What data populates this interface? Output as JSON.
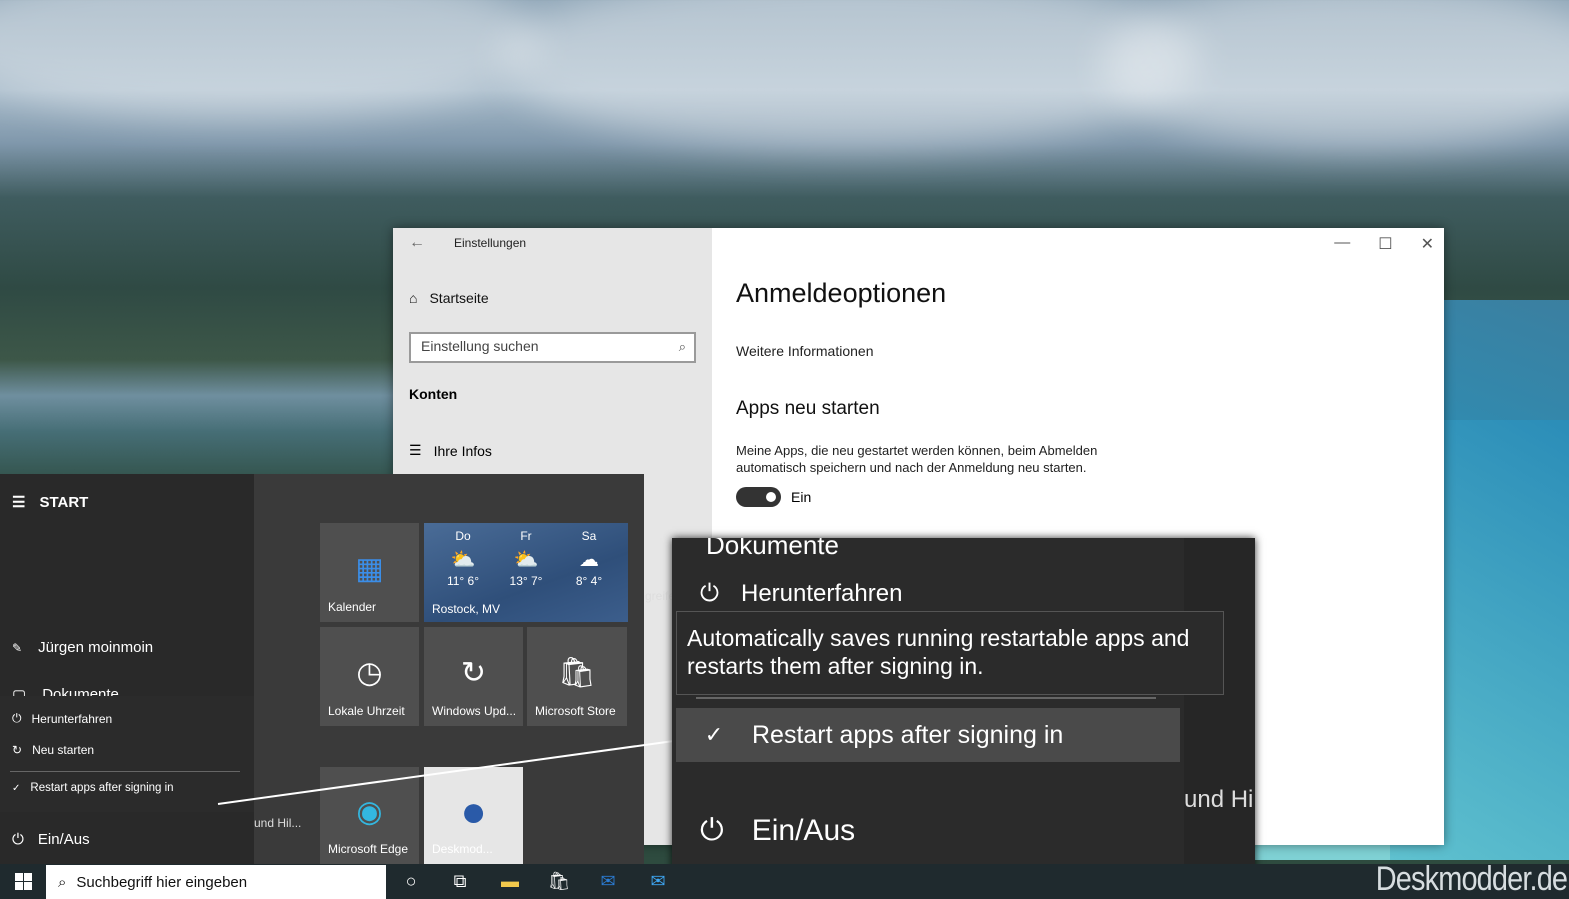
{
  "settings": {
    "title": "Einstellungen",
    "home": "Startseite",
    "search_placeholder": "Einstellung suchen",
    "section": "Konten",
    "nav_item": "Ihre Infos",
    "page_title": "Anmeldeoptionen",
    "more_info": "Weitere Informationen",
    "subtitle": "Apps neu starten",
    "description": "Meine Apps, die neu gestartet werden können, beim Abmelden automatisch speichern und nach der Anmeldung neu starten.",
    "toggle_label": "Ein",
    "toggle_on": true
  },
  "start": {
    "heading": "START",
    "user": "Jürgen moinmoin",
    "documents": "Dokumente",
    "power_menu": {
      "shutdown": "Herunterfahren",
      "restart": "Neu starten",
      "restart_apps": "Restart apps after signing in"
    },
    "power": "Ein/Aus",
    "cut_text_1": "greife",
    "cut_text_2": "und Hil...",
    "tiles": {
      "calendar": "Kalender",
      "clock": "Lokale Uhrzeit",
      "update": "Windows Upd...",
      "store": "Microsoft Store",
      "edge": "Microsoft Edge",
      "deskmodder": "Deskmod..."
    },
    "weather": {
      "location": "Rostock, MV",
      "days": [
        {
          "day": "Do",
          "temp": "11° 6°"
        },
        {
          "day": "Fr",
          "temp": "13° 7°"
        },
        {
          "day": "Sa",
          "temp": "8° 4°"
        }
      ]
    }
  },
  "zoom": {
    "documents": "Dokumente",
    "shutdown": "Herunterfahren",
    "tooltip": "Automatically saves running restartable apps and restarts them after signing in.",
    "restart_apps": "Restart apps after signing in",
    "power": "Ein/Aus",
    "cut_text": "und Hi"
  },
  "taskbar": {
    "search_placeholder": "Suchbegriff hier eingeben"
  },
  "watermark": "Deskmodder.de"
}
